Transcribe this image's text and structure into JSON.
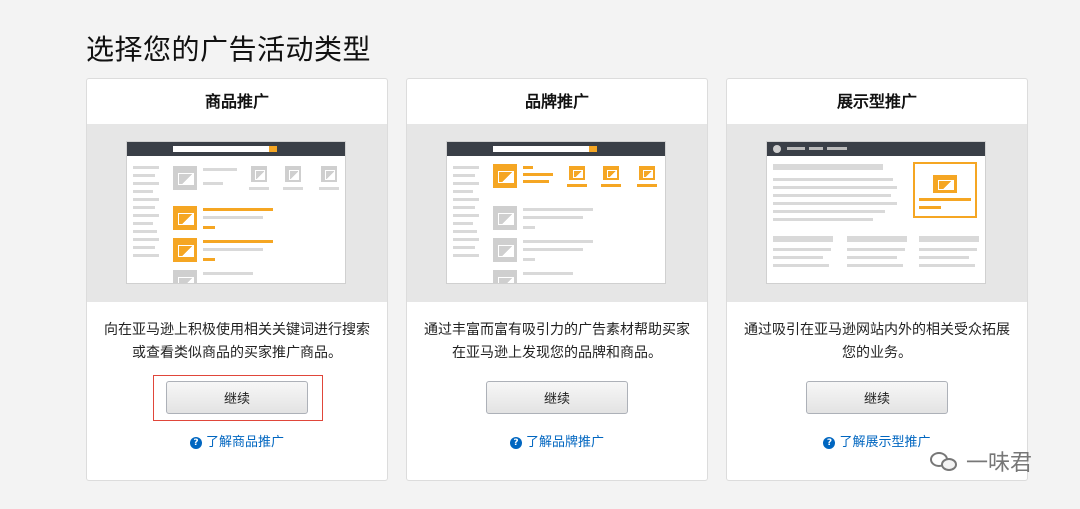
{
  "page": {
    "title": "选择您的广告活动类型"
  },
  "cards": [
    {
      "title": "商品推广",
      "description": "向在亚马逊上积极使用相关关键词进行搜索或查看类似商品的买家推广商品。",
      "button_label": "继续",
      "learn_more": "了解商品推广",
      "preview_logo": "amazon"
    },
    {
      "title": "品牌推广",
      "description": "通过丰富而富有吸引力的广告素材帮助买家在亚马逊上发现您的品牌和商品。",
      "button_label": "继续",
      "learn_more": "了解品牌推广",
      "preview_logo": "amazon"
    },
    {
      "title": "展示型推广",
      "description": "通过吸引在亚马逊网站内外的相关受众拓展您的业务。",
      "button_label": "继续",
      "learn_more": "了解展示型推广"
    }
  ],
  "icons": {
    "help": "question-circle-icon",
    "watermark": "wechat-icon"
  },
  "colors": {
    "accent": "#f5a623",
    "link": "#0066c0",
    "highlight": "#e0463a"
  },
  "watermark": {
    "text": "一味君"
  }
}
